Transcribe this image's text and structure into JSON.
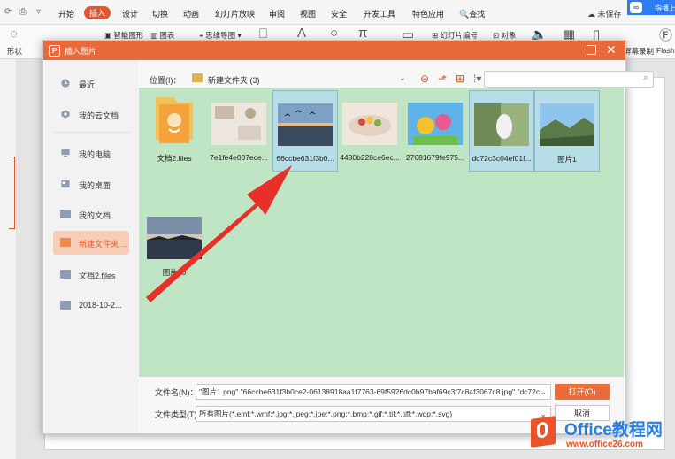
{
  "ribbon": {
    "tabs": [
      "开始",
      "插入",
      "设计",
      "切换",
      "动画",
      "幻灯片放映",
      "审阅",
      "视图",
      "安全",
      "开发工具",
      "特色应用"
    ],
    "active_tab": "插入",
    "search_label": "查找",
    "unsaved_label": "未保存",
    "cloud_label": "指播上",
    "toolbar": {
      "shape_label": "形状",
      "smartart_label": "智能图形",
      "chart_label": "图表",
      "mindmap_label": "思维导图",
      "slide_number_label": "幻灯片编号",
      "object_label": "对象",
      "screen_record_label": "屏幕录制",
      "flash_label": "Flash"
    }
  },
  "dialog": {
    "title": "插入图片",
    "sidebar": [
      {
        "label": "最近",
        "icon": "clock-icon"
      },
      {
        "label": "我的云文档",
        "icon": "cloud-icon"
      },
      {
        "label": "我的电脑",
        "icon": "computer-icon"
      },
      {
        "label": "我的桌面",
        "icon": "desktop-icon"
      },
      {
        "label": "我的文档",
        "icon": "folder-icon"
      },
      {
        "label": "新建文件夹 ...",
        "icon": "folder-icon"
      },
      {
        "label": "文档2.files",
        "icon": "folder-icon"
      },
      {
        "label": "2018-10-2...",
        "icon": "folder-icon"
      }
    ],
    "location_label": "位置(I)：",
    "location_value": "新建文件夹 (3)",
    "files": [
      {
        "name": "文档2.files",
        "kind": "folder"
      },
      {
        "name": "7e1fe4e007ece...",
        "kind": "image"
      },
      {
        "name": "66ccbe631f3b0...",
        "kind": "image"
      },
      {
        "name": "4480b228ce6ec...",
        "kind": "image"
      },
      {
        "name": "27681679fe975...",
        "kind": "image"
      },
      {
        "name": "dc72c3c04ef01f...",
        "kind": "image"
      },
      {
        "name": "图片1",
        "kind": "image"
      },
      {
        "name": "图片10",
        "kind": "image"
      }
    ],
    "filename_label": "文件名(N)：",
    "filename_value": "\"图片1.png\" \"66ccbe631f3b0ce2-06138918aa1f7763-69f5926dc0b97baf69c3f7c84f3067c8.jpg\" \"dc72c",
    "filetype_label": "文件类型(T)：",
    "filetype_value": "所有图片(*.emf;*.wmf;*.jpg;*.jpeg;*.jpe;*.png;*.bmp;*.gif;*.tif;*.tiff;*.wdp;*.svg)",
    "open_label": "打开(O)",
    "cancel_label": "取消"
  },
  "watermark": {
    "main": "Office教程网",
    "sub": "www.office26.com"
  },
  "colors": {
    "accent": "#e86a3b",
    "file_area": "#bfe5c4",
    "arrow": "#e8302a",
    "watermark_blue": "#2a7de1"
  }
}
